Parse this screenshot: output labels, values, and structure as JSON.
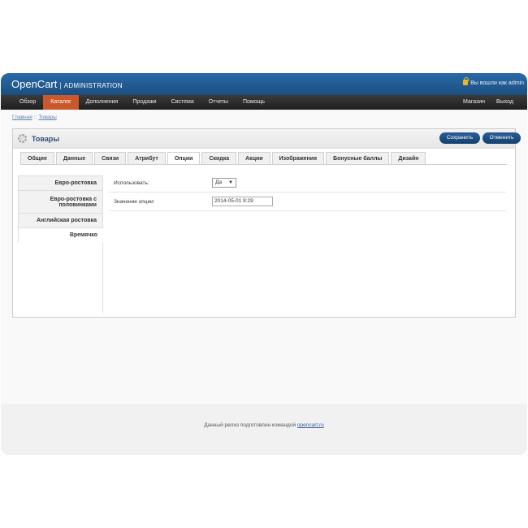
{
  "header": {
    "logo": "OpenCart",
    "separator": "|",
    "subtitle": "ADMINISTRATION",
    "login_text": "Вы вошли как admin"
  },
  "menu": {
    "left": [
      "Обзор",
      "Каталог",
      "Дополнения",
      "Продажи",
      "Система",
      "Отчеты",
      "Помощь"
    ],
    "active_index": 1,
    "right": [
      "Магазин",
      "Выход"
    ]
  },
  "breadcrumb": {
    "items": [
      "Главная",
      "Товары"
    ],
    "separator": "::"
  },
  "page": {
    "title": "Товары",
    "save_label": "Сохранить",
    "cancel_label": "Отменить"
  },
  "tabs": [
    "Общие",
    "Данные",
    "Связи",
    "Атрибут",
    "Опции",
    "Скидка",
    "Акции",
    "Изображения",
    "Бонусные баллы",
    "Дизайн"
  ],
  "active_tab": "Опции",
  "option_tabs": [
    "Евро-ростовка",
    "Евро-ростовка с половинками",
    "Английская ростовка",
    "Времячко"
  ],
  "active_option_tab": "Времячко",
  "form": {
    "use_label": "Использовать:",
    "use_value": "Да",
    "value_label": "Значение опции:",
    "value_value": "2014-05-01 9:29"
  },
  "footer": {
    "text": "Данный релиз подготовлен командой",
    "link": "opencart.ru"
  },
  "colors": {
    "header": "#1b4f80",
    "menu_active": "#c9582c",
    "button": "#13406f"
  }
}
